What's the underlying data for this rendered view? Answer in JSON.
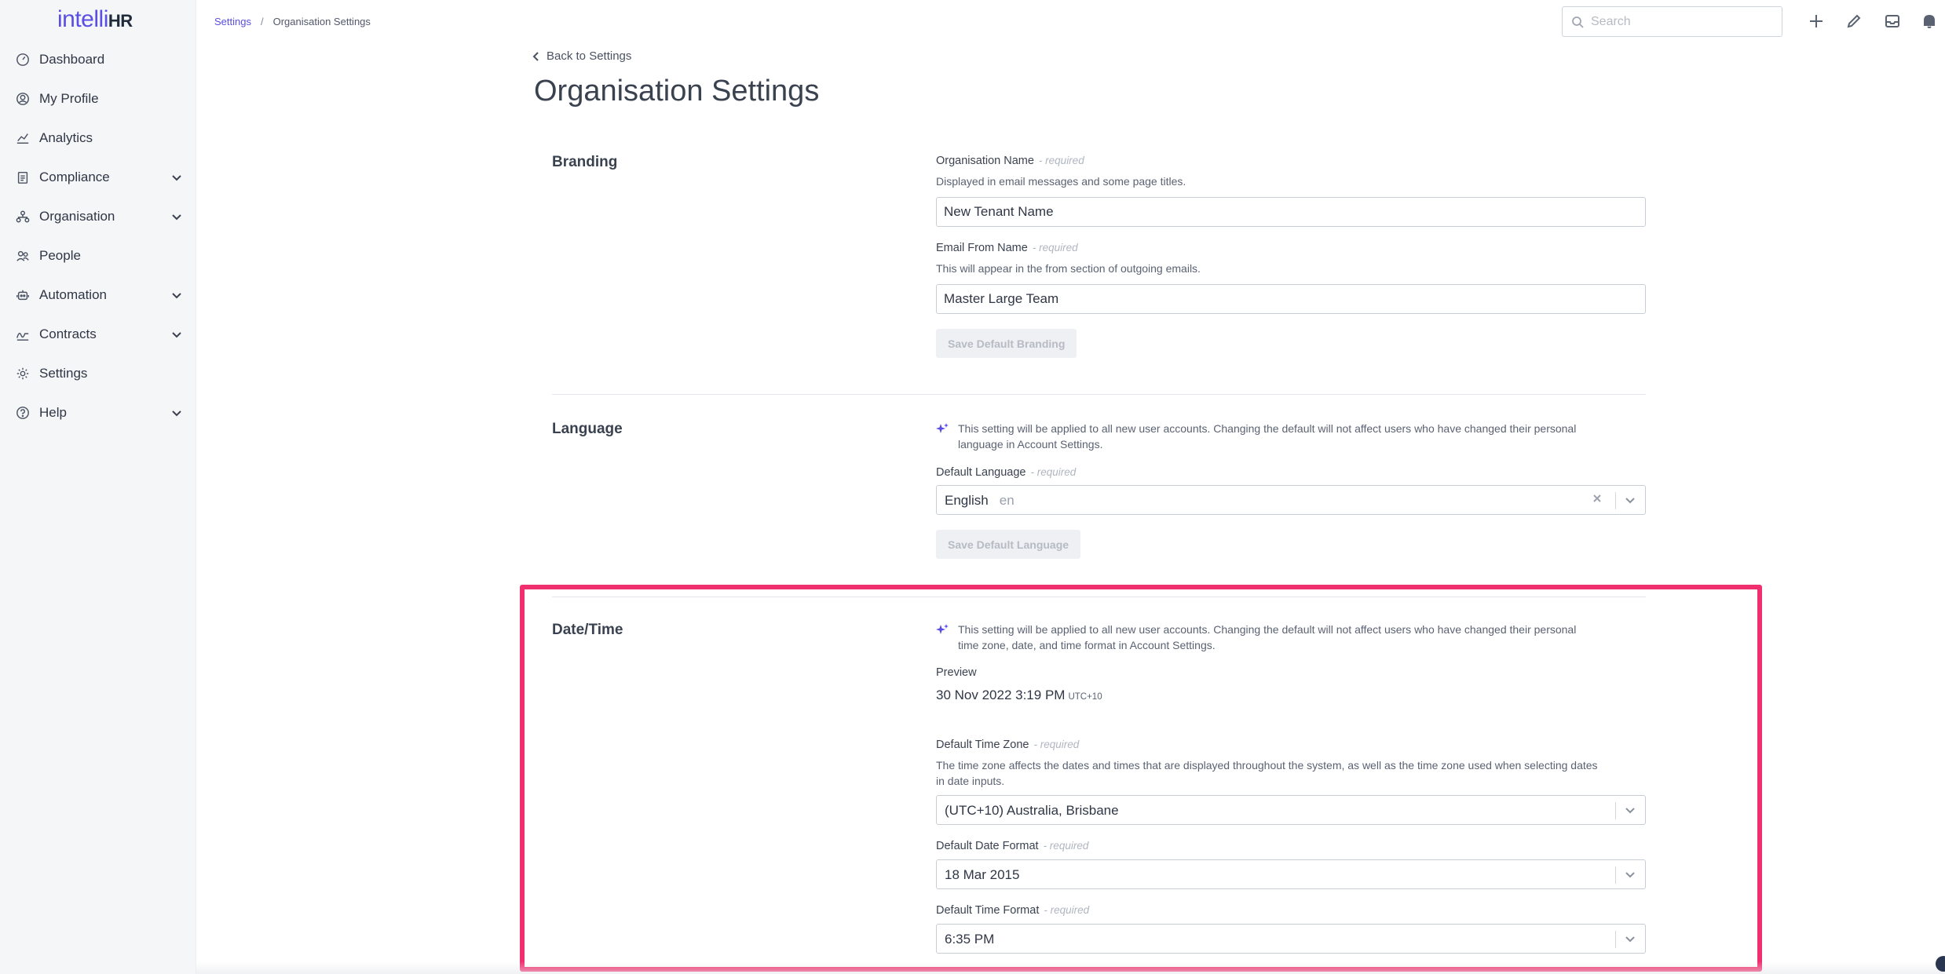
{
  "brand": {
    "part1": "intelli",
    "part2": "HR"
  },
  "sidebar": {
    "items": [
      {
        "label": "Dashboard",
        "icon": "gauge-icon",
        "expandable": false
      },
      {
        "label": "My Profile",
        "icon": "user-circle-icon",
        "expandable": false
      },
      {
        "label": "Analytics",
        "icon": "chart-icon",
        "expandable": false
      },
      {
        "label": "Compliance",
        "icon": "clipboard-icon",
        "expandable": true
      },
      {
        "label": "Organisation",
        "icon": "org-chart-icon",
        "expandable": true
      },
      {
        "label": "People",
        "icon": "people-icon",
        "expandable": false
      },
      {
        "label": "Automation",
        "icon": "robot-icon",
        "expandable": true
      },
      {
        "label": "Contracts",
        "icon": "signature-icon",
        "expandable": true
      },
      {
        "label": "Settings",
        "icon": "gear-icon",
        "expandable": false
      },
      {
        "label": "Help",
        "icon": "help-circle-icon",
        "expandable": true
      }
    ]
  },
  "breadcrumb": {
    "parent": "Settings",
    "separator": "/",
    "current": "Organisation Settings"
  },
  "search": {
    "placeholder": "Search"
  },
  "header": {
    "back_label": "Back to Settings",
    "title": "Organisation Settings"
  },
  "branding": {
    "title": "Branding",
    "org_name": {
      "label": "Organisation Name",
      "required": "- required",
      "help": "Displayed in email messages and some page titles.",
      "value": "New Tenant Name"
    },
    "email_from": {
      "label": "Email From Name",
      "required": "- required",
      "help": "This will appear in the from section of outgoing emails.",
      "value": "Master Large Team"
    },
    "save_label": "Save Default Branding"
  },
  "language": {
    "title": "Language",
    "info_line1": "This setting will be applied to all new user accounts. Changing the default will not affect users who have changed their personal",
    "info_line2": "language in Account Settings.",
    "default_label": "Default Language",
    "required": "- required",
    "selected": "English",
    "selected_code": "en",
    "save_label": "Save Default Language"
  },
  "datetime": {
    "title": "Date/Time",
    "info_line1": "This setting will be applied to all new user accounts. Changing the default will not affect users who have changed their personal",
    "info_line2": "time zone, date, and time format in Account Settings.",
    "preview_label": "Preview",
    "preview_value": "30 Nov 2022 3:19 PM",
    "preview_tz": "UTC+10",
    "timezone": {
      "label": "Default Time Zone",
      "required": "- required",
      "help_line1": "The time zone affects the dates and times that are displayed throughout the system, as well as the time zone used when selecting dates",
      "help_line2": "in date inputs.",
      "selected": "(UTC+10) Australia, Brisbane"
    },
    "date_format": {
      "label": "Default Date Format",
      "required": "- required",
      "selected": "18 Mar 2015"
    },
    "time_format": {
      "label": "Default Time Format",
      "required": "- required",
      "selected": "6:35 PM"
    }
  },
  "colors": {
    "accent": "#5a4fe0",
    "highlight": "#f0306e"
  }
}
